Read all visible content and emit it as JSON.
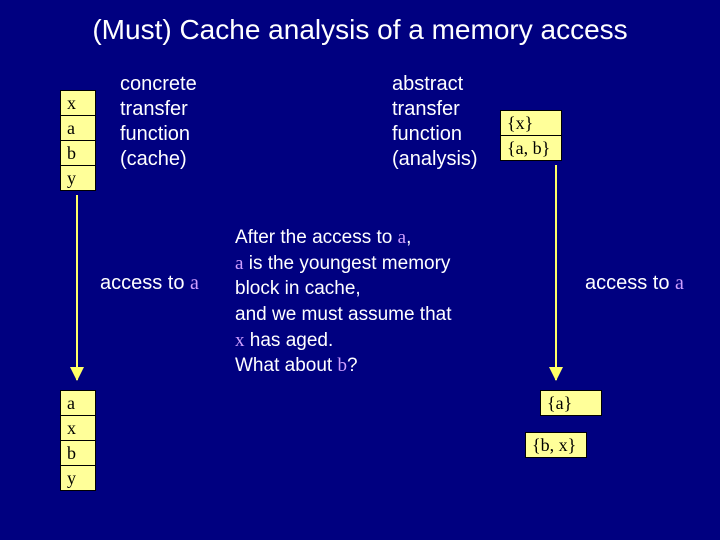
{
  "title": "(Must) Cache analysis of a memory access",
  "left": {
    "transfer_label_l1": "concrete",
    "transfer_label_l2": "transfer",
    "transfer_label_l3": "function",
    "transfer_label_l4": "(cache)",
    "access_prefix": "access to ",
    "access_var": "a",
    "cache_before": [
      "x",
      "a",
      "b",
      "y"
    ],
    "cache_after": [
      "a",
      "x",
      "b",
      "y"
    ]
  },
  "right": {
    "transfer_label_l1": "abstract",
    "transfer_label_l2": "transfer",
    "transfer_label_l3": "function",
    "transfer_label_l4": "(analysis)",
    "access_prefix": "access to ",
    "access_var": "a",
    "cache_before": [
      "{x}",
      "{a, b}"
    ],
    "cache_after": [
      "{a}",
      "{b, x}"
    ]
  },
  "explain": {
    "l1a": "After the access to ",
    "l1b": "a",
    "l1c": ",",
    "l2a": "a",
    "l2b": " is the youngest memory",
    "l3": "block in cache,",
    "l4": "and we must assume that",
    "l5a": "x",
    "l5b": " has aged.",
    "l6a": "What about ",
    "l6b": "b",
    "l6c": "?"
  }
}
